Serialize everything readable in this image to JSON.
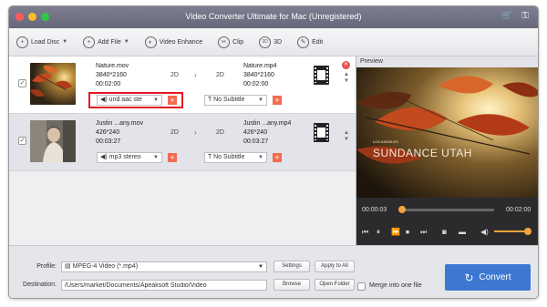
{
  "window": {
    "title": "Video Converter Ultimate for Mac (Unregistered)"
  },
  "toolbar": {
    "load_disc": "Load Disc",
    "add_file": "Add File",
    "video_enhance": "Video Enhance",
    "clip": "Clip",
    "three_d": "3D",
    "edit": "Edit"
  },
  "files": [
    {
      "source_name": "Nature.mov",
      "resolution": "3840*2160",
      "duration": "00:02:00",
      "in_mode": "2D",
      "out_mode": "2D",
      "output_name": "Nature.mp4",
      "output_resolution": "3840*2160",
      "output_duration": "00:02:00",
      "audio": "und aac ste",
      "subtitle": "No Subtitle"
    },
    {
      "source_name": "Justin ...any.mov",
      "resolution": "426*240",
      "duration": "00:03:27",
      "in_mode": "2D",
      "out_mode": "2D",
      "output_name": "Justin ...any.mp4",
      "output_resolution": "426*240",
      "output_duration": "00:03:27",
      "audio": "mp3 stereo",
      "subtitle": "No Subtitle"
    }
  ],
  "preview": {
    "label": "Preview",
    "overlay_small": "LOS ANGELES",
    "overlay_big": "SUNDANCE UTAH",
    "current_time": "00:00:03",
    "total_time": "00:02:00",
    "seek_fraction": 0.03,
    "volume_fraction": 1.0
  },
  "bottom": {
    "profile_label": "Profile:",
    "profile_value": "MPEG-4 Video (*.mp4)",
    "settings": "Settings",
    "apply_to_all": "Apply to All",
    "destination_label": "Destination:",
    "destination_value": "/Users/market/Documents/Apeaksoft Studio/Video",
    "browse": "Browse",
    "open_folder": "Open Folder",
    "merge_label": "Merge into one file",
    "convert": "Convert"
  },
  "colors": {
    "accent": "#3c78d1",
    "highlight_box": "#e31b23",
    "add_button": "#f36b4f",
    "seek": "#f3a33d"
  }
}
